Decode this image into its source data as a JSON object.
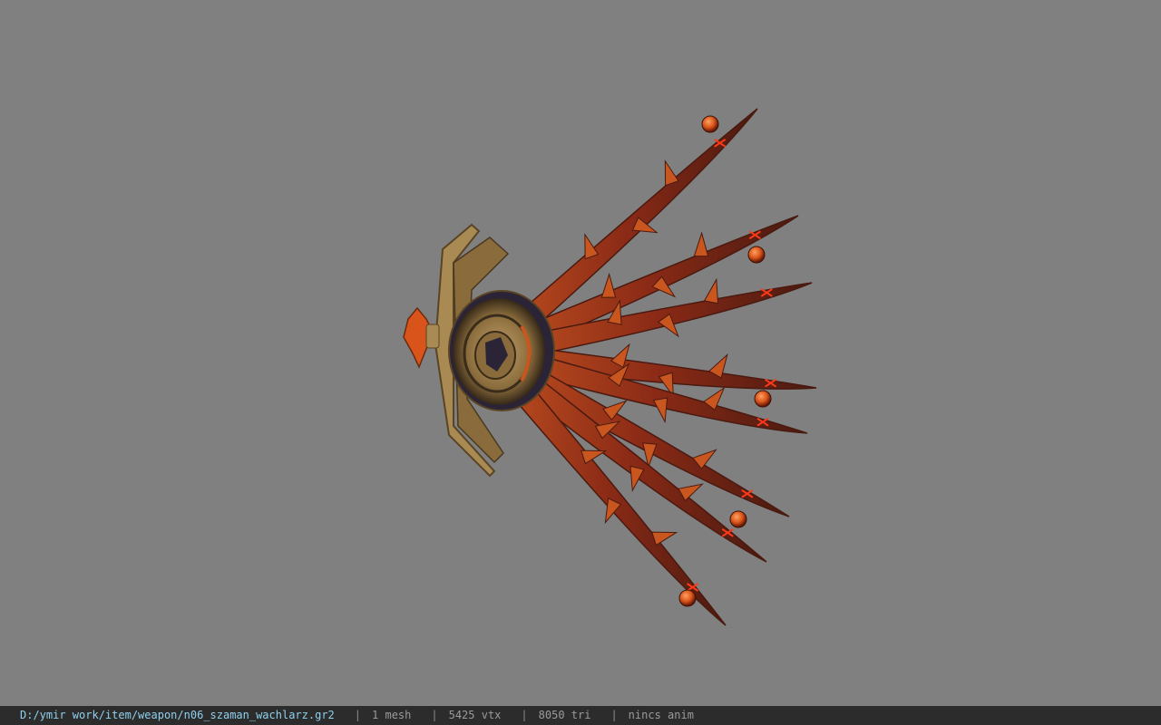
{
  "viewport": {
    "background_color": "#808080",
    "model_name": "fan weapon model",
    "colors": {
      "blade_main": "#8a2a16",
      "blade_highlight": "#c8561e",
      "blade_dark": "#4a1a10",
      "rune": "#ff3a1a",
      "orb": "#d8541a",
      "gold": "#a88a52",
      "gold_dark": "#5a4426",
      "emblem_dark": "#2a2436"
    }
  },
  "statusbar": {
    "file_path": "D:/ymir work/item/weapon/n06_szaman_wachlarz.gr2",
    "separator": "|",
    "mesh_count": "1 mesh",
    "vertex_count": "5425 vtx",
    "triangle_count": "8050 tri",
    "animation": "nincs anim",
    "background_color": "#2c2c2c",
    "path_color": "#8fd0ee"
  }
}
